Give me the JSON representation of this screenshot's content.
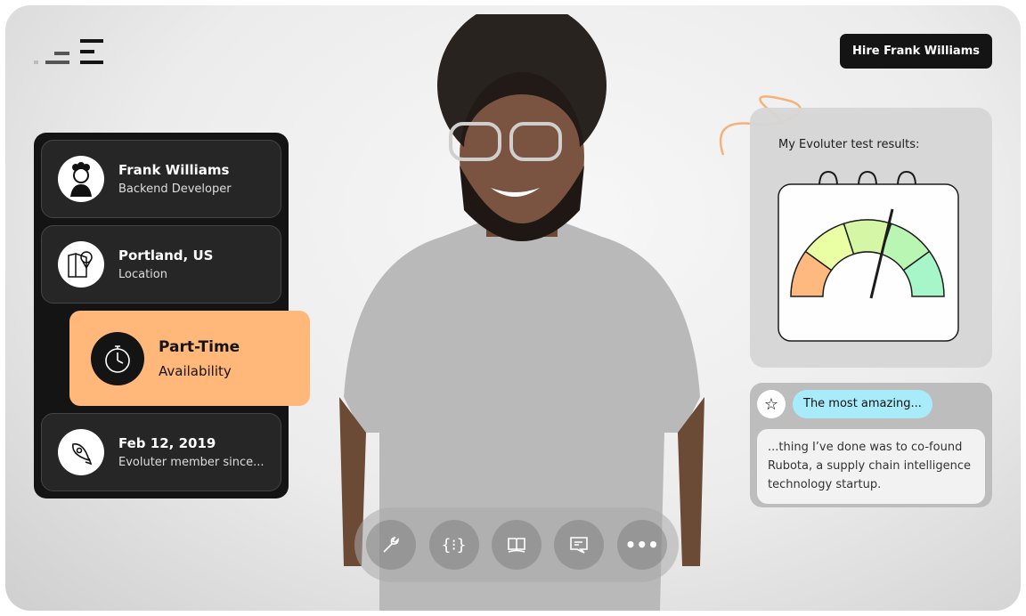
{
  "header": {
    "hire_label": "Hire Frank Williams"
  },
  "profile": [
    {
      "title": "Frank Williams",
      "subtitle": "Backend Developer",
      "icon": "avatar-illustration"
    },
    {
      "title": "Portland, US",
      "subtitle": "Location",
      "icon": "map-pin-icon"
    },
    {
      "title": "Part-Time",
      "subtitle": "Availability",
      "icon": "stopwatch-icon"
    },
    {
      "title": "Feb 12, 2019",
      "subtitle": "Evoluter member since...",
      "icon": "rocket-icon"
    }
  ],
  "test": {
    "title": "My Evoluter test results:",
    "gauge_segments": [
      "#ffb77a",
      "#eaffa0",
      "#d4f7a0",
      "#b8f7b0",
      "#a4f7c8"
    ]
  },
  "quote": {
    "heading": "The most amazing...",
    "body": "...thing I’ve done was to co-found Rubota, a supply chain intelligence technology startup."
  },
  "dock": [
    "wrench-icon",
    "code-braces-icon",
    "book-icon",
    "message-icon",
    "more-icon"
  ],
  "colors": {
    "accent": "#ffb77a",
    "pill": "#a8ecfb",
    "dark": "#141414"
  }
}
